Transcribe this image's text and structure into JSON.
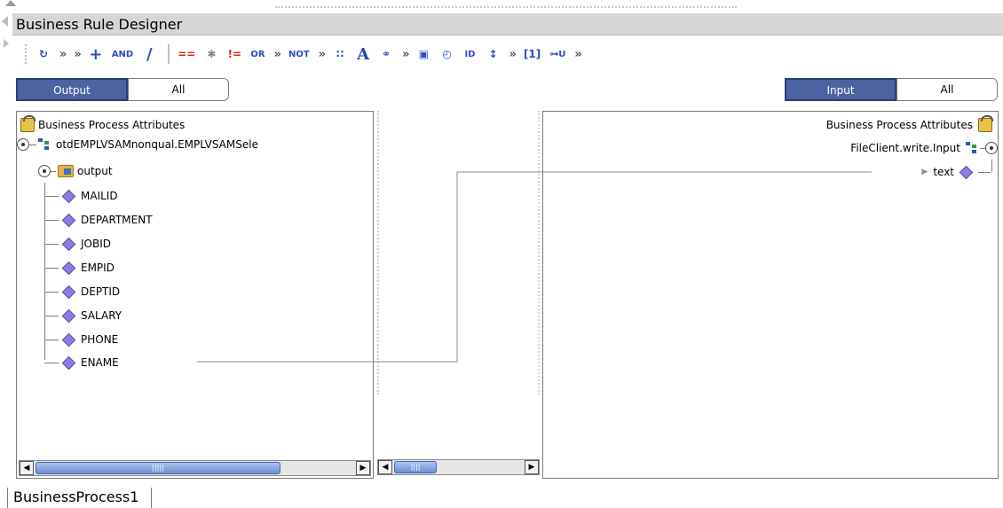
{
  "window": {
    "title": "Business Rule Designer"
  },
  "toolbar": {
    "items": [
      {
        "name": "refresh-icon",
        "label": "↻"
      },
      {
        "name": "chevron-more-icon",
        "label": "»"
      },
      {
        "name": "chevron-more-icon",
        "label": "»"
      },
      {
        "name": "add-icon",
        "label": "+"
      },
      {
        "name": "and-operator",
        "label": "AND"
      },
      {
        "name": "divide-icon",
        "label": "/"
      },
      {
        "name": "equals-operator",
        "label": "=="
      },
      {
        "name": "multiply-icon",
        "label": "✱"
      },
      {
        "name": "not-equals-operator",
        "label": "!="
      },
      {
        "name": "or-operator",
        "label": "OR"
      },
      {
        "name": "chevron-more-icon",
        "label": "»"
      },
      {
        "name": "not-operator",
        "label": "NOT"
      },
      {
        "name": "chevron-more-icon",
        "label": "»"
      },
      {
        "name": "concat-icon",
        "label": "∷"
      },
      {
        "name": "text-icon",
        "label": "A"
      },
      {
        "name": "link-icon",
        "label": "⚭"
      },
      {
        "name": "chevron-more-icon",
        "label": "»"
      },
      {
        "name": "doc-icon",
        "label": "▣"
      },
      {
        "name": "clock-icon",
        "label": "◴"
      },
      {
        "name": "id-icon",
        "label": "ID"
      },
      {
        "name": "split-icon",
        "label": "↕"
      },
      {
        "name": "chevron-more-icon",
        "label": "»"
      },
      {
        "name": "index-icon",
        "label": "[1]"
      },
      {
        "name": "uri-icon",
        "label": "⊶U"
      },
      {
        "name": "chevron-more-icon",
        "label": "»"
      }
    ]
  },
  "left_filter": {
    "selected": "Output",
    "other": "All"
  },
  "right_filter": {
    "selected": "Input",
    "other": "All"
  },
  "left_tree": {
    "root": "Business Process Attributes",
    "node": "otdEMPLVSAMnonqual.EMPLVSAMSele",
    "folder": "output",
    "fields": [
      "MAILID",
      "DEPARTMENT",
      "JOBID",
      "EMPID",
      "DEPTID",
      "SALARY",
      "PHONE",
      "ENAME"
    ]
  },
  "right_tree": {
    "root": "Business Process Attributes",
    "node": "FileClient.write.Input",
    "field": "text"
  },
  "status": {
    "tab": "BusinessProcess1"
  },
  "colors": {
    "selected_button": "#4d62a3",
    "field_diamond": "#8a7ee0",
    "title_bar": "#d6d6d6"
  }
}
